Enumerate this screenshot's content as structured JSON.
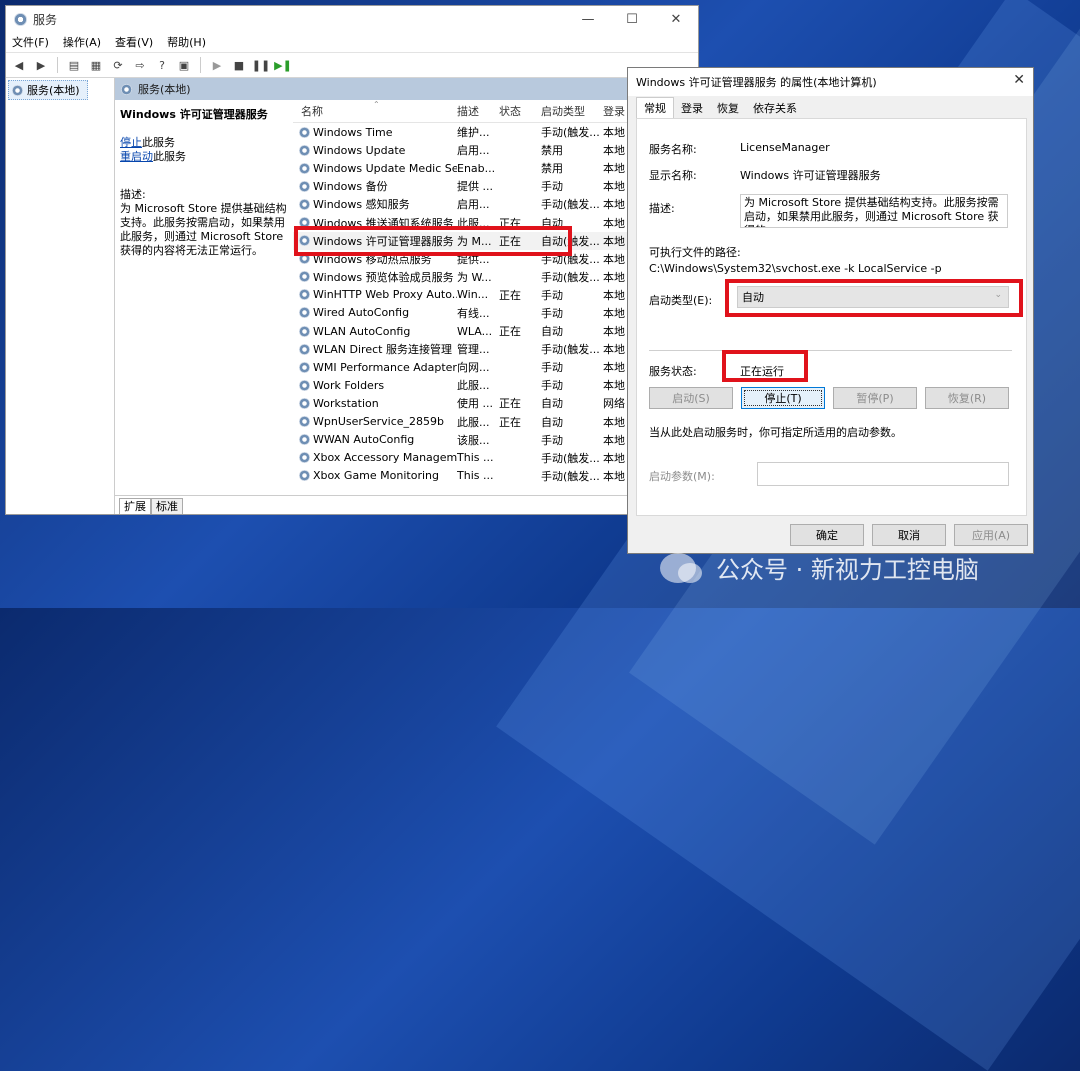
{
  "services_window": {
    "title": "服务",
    "menu": [
      "文件(F)",
      "操作(A)",
      "查看(V)",
      "帮助(H)"
    ],
    "tree_item": "服务(本地)",
    "header": "服务(本地)",
    "selected_service_title": "Windows 许可证管理器服务",
    "stop_link": "停止",
    "stop_suffix": "此服务",
    "restart_link": "重启动",
    "restart_suffix": "此服务",
    "desc_label": "描述:",
    "desc_text": "为 Microsoft Store 提供基础结构支持。此服务按需启动，如果禁用此服务，则通过 Microsoft Store 获得的内容将无法正常运行。",
    "columns": [
      "名称",
      "描述",
      "状态",
      "启动类型",
      "登录"
    ],
    "rows": [
      {
        "name": "Windows Time",
        "desc": "维护...",
        "state": "",
        "start": "手动(触发...",
        "logon": "本地"
      },
      {
        "name": "Windows Update",
        "desc": "启用...",
        "state": "",
        "start": "禁用",
        "logon": "本地"
      },
      {
        "name": "Windows Update Medic Se...",
        "desc": "Enab...",
        "state": "",
        "start": "禁用",
        "logon": "本地"
      },
      {
        "name": "Windows 备份",
        "desc": "提供 ...",
        "state": "",
        "start": "手动",
        "logon": "本地"
      },
      {
        "name": "Windows 感知服务",
        "desc": "启用...",
        "state": "",
        "start": "手动(触发...",
        "logon": "本地"
      },
      {
        "name": "Windows 推送通知系统服务",
        "desc": "此服...",
        "state": "正在",
        "start": "自动",
        "logon": "本地"
      },
      {
        "name": "Windows 许可证管理器服务",
        "desc": "为 M...",
        "state": "正在",
        "start": "自动(触发...",
        "logon": "本地"
      },
      {
        "name": "Windows 移动热点服务",
        "desc": "提供...",
        "state": "",
        "start": "手动(触发...",
        "logon": "本地"
      },
      {
        "name": "Windows 预览体验成员服务",
        "desc": "为 W...",
        "state": "",
        "start": "手动(触发...",
        "logon": "本地"
      },
      {
        "name": "WinHTTP Web Proxy Auto...",
        "desc": "Win...",
        "state": "正在",
        "start": "手动",
        "logon": "本地"
      },
      {
        "name": "Wired AutoConfig",
        "desc": "有线...",
        "state": "",
        "start": "手动",
        "logon": "本地"
      },
      {
        "name": "WLAN AutoConfig",
        "desc": "WLA...",
        "state": "正在",
        "start": "自动",
        "logon": "本地"
      },
      {
        "name": "WLAN Direct 服务连接管理",
        "desc": "管理...",
        "state": "",
        "start": "手动(触发...",
        "logon": "本地"
      },
      {
        "name": "WMI Performance Adapter",
        "desc": "向网...",
        "state": "",
        "start": "手动",
        "logon": "本地"
      },
      {
        "name": "Work Folders",
        "desc": "此服...",
        "state": "",
        "start": "手动",
        "logon": "本地"
      },
      {
        "name": "Workstation",
        "desc": "使用 ...",
        "state": "正在",
        "start": "自动",
        "logon": "网络"
      },
      {
        "name": "WpnUserService_2859b",
        "desc": "此服...",
        "state": "正在",
        "start": "自动",
        "logon": "本地"
      },
      {
        "name": "WWAN AutoConfig",
        "desc": "该服...",
        "state": "",
        "start": "手动",
        "logon": "本地"
      },
      {
        "name": "Xbox Accessory Managem...",
        "desc": "This ...",
        "state": "",
        "start": "手动(触发...",
        "logon": "本地"
      },
      {
        "name": "Xbox Game Monitoring",
        "desc": "This ...",
        "state": "",
        "start": "手动(触发...",
        "logon": "本地"
      }
    ],
    "tabs": [
      "扩展",
      "标准"
    ]
  },
  "dialog": {
    "title": "Windows 许可证管理器服务 的属性(本地计算机)",
    "tabs": [
      "常规",
      "登录",
      "恢复",
      "依存关系"
    ],
    "service_name_label": "服务名称:",
    "service_name": "LicenseManager",
    "display_name_label": "显示名称:",
    "display_name": "Windows 许可证管理器服务",
    "desc_label": "描述:",
    "desc_text": "为 Microsoft Store 提供基础结构支持。此服务按需启动，如果禁用此服务，则通过 Microsoft Store 获得的",
    "path_label": "可执行文件的路径:",
    "path_value": "C:\\Windows\\System32\\svchost.exe -k LocalService -p",
    "startup_type_label": "启动类型(E):",
    "startup_type_value": "自动",
    "status_label": "服务状态:",
    "status_value": "正在运行",
    "buttons": {
      "start": "启动(S)",
      "stop": "停止(T)",
      "pause": "暂停(P)",
      "resume": "恢复(R)"
    },
    "hint": "当从此处启动服务时，你可指定所适用的启动参数。",
    "param_label": "启动参数(M):",
    "ok": "确定",
    "cancel": "取消",
    "apply": "应用(A)"
  },
  "watermark": "公众号 · 新视力工控电脑"
}
